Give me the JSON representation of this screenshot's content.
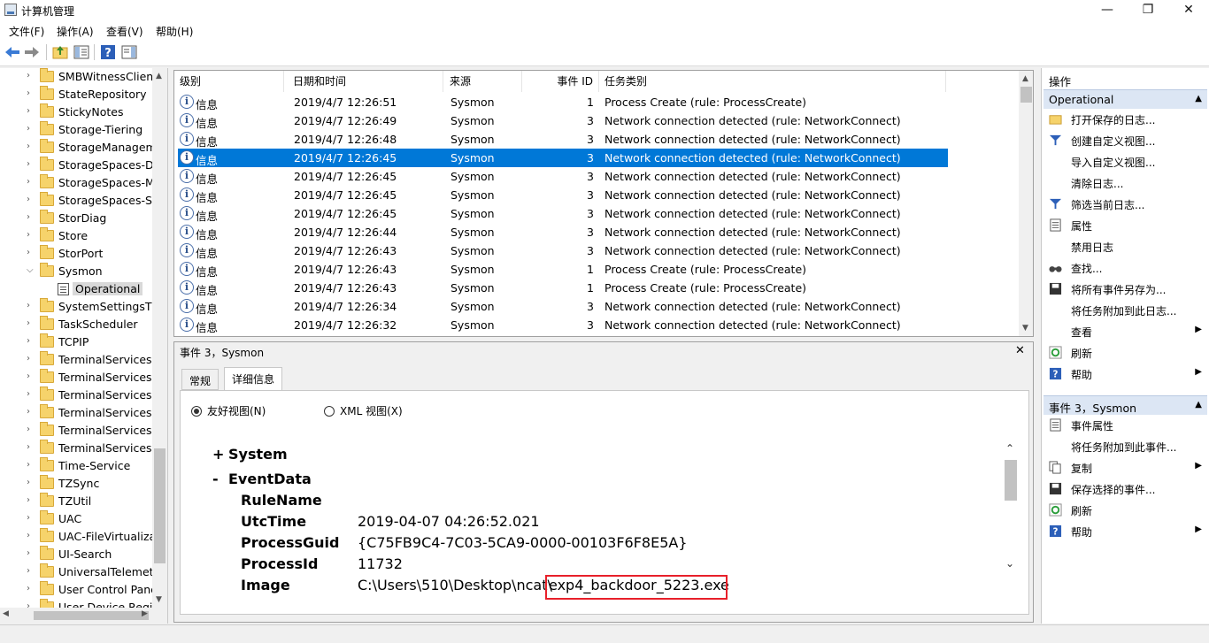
{
  "window": {
    "title": "计算机管理",
    "minimize": "—",
    "maximize": "❐",
    "close": "✕"
  },
  "menu": [
    "文件(F)",
    "操作(A)",
    "查看(V)",
    "帮助(H)"
  ],
  "tree": {
    "items": [
      {
        "label": "SMBWitnessClient",
        "expanded": false
      },
      {
        "label": "StateRepository",
        "expanded": false
      },
      {
        "label": "StickyNotes",
        "expanded": false
      },
      {
        "label": "Storage-Tiering",
        "expanded": false
      },
      {
        "label": "StorageManagem",
        "expanded": false
      },
      {
        "label": "StorageSpaces-Dr",
        "expanded": false
      },
      {
        "label": "StorageSpaces-M",
        "expanded": false
      },
      {
        "label": "StorageSpaces-Sp",
        "expanded": false
      },
      {
        "label": "StorDiag",
        "expanded": false
      },
      {
        "label": "Store",
        "expanded": false
      },
      {
        "label": "StorPort",
        "expanded": false
      },
      {
        "label": "Sysmon",
        "expanded": true
      },
      {
        "label": "Operational",
        "child": true
      },
      {
        "label": "SystemSettingsThr",
        "expanded": false
      },
      {
        "label": "TaskScheduler",
        "expanded": false
      },
      {
        "label": "TCPIP",
        "expanded": false
      },
      {
        "label": "TerminalServices-C",
        "expanded": false
      },
      {
        "label": "TerminalServices-C",
        "expanded": false
      },
      {
        "label": "TerminalServices-L",
        "expanded": false
      },
      {
        "label": "TerminalServices-F",
        "expanded": false
      },
      {
        "label": "TerminalServices-F",
        "expanded": false
      },
      {
        "label": "TerminalServices-F",
        "expanded": false
      },
      {
        "label": "Time-Service",
        "expanded": false
      },
      {
        "label": "TZSync",
        "expanded": false
      },
      {
        "label": "TZUtil",
        "expanded": false
      },
      {
        "label": "UAC",
        "expanded": false
      },
      {
        "label": "UAC-FileVirtualizat",
        "expanded": false
      },
      {
        "label": "UI-Search",
        "expanded": false
      },
      {
        "label": "UniversalTelemetr",
        "expanded": false
      },
      {
        "label": "User Control Pane",
        "expanded": false
      },
      {
        "label": "User Device Regis",
        "expanded": false
      }
    ]
  },
  "list": {
    "columns": [
      "级别",
      "日期和时间",
      "来源",
      "事件 ID",
      "任务类别"
    ],
    "rows": [
      {
        "level": "信息",
        "datetime": "2019/4/7 12:26:51",
        "source": "Sysmon",
        "id": "1",
        "task": "Process Create (rule: ProcessCreate)"
      },
      {
        "level": "信息",
        "datetime": "2019/4/7 12:26:49",
        "source": "Sysmon",
        "id": "3",
        "task": "Network connection detected (rule: NetworkConnect)"
      },
      {
        "level": "信息",
        "datetime": "2019/4/7 12:26:48",
        "source": "Sysmon",
        "id": "3",
        "task": "Network connection detected (rule: NetworkConnect)"
      },
      {
        "level": "信息",
        "datetime": "2019/4/7 12:26:45",
        "source": "Sysmon",
        "id": "3",
        "task": "Network connection detected (rule: NetworkConnect)",
        "selected": true
      },
      {
        "level": "信息",
        "datetime": "2019/4/7 12:26:45",
        "source": "Sysmon",
        "id": "3",
        "task": "Network connection detected (rule: NetworkConnect)"
      },
      {
        "level": "信息",
        "datetime": "2019/4/7 12:26:45",
        "source": "Sysmon",
        "id": "3",
        "task": "Network connection detected (rule: NetworkConnect)"
      },
      {
        "level": "信息",
        "datetime": "2019/4/7 12:26:45",
        "source": "Sysmon",
        "id": "3",
        "task": "Network connection detected (rule: NetworkConnect)"
      },
      {
        "level": "信息",
        "datetime": "2019/4/7 12:26:44",
        "source": "Sysmon",
        "id": "3",
        "task": "Network connection detected (rule: NetworkConnect)"
      },
      {
        "level": "信息",
        "datetime": "2019/4/7 12:26:43",
        "source": "Sysmon",
        "id": "3",
        "task": "Network connection detected (rule: NetworkConnect)"
      },
      {
        "level": "信息",
        "datetime": "2019/4/7 12:26:43",
        "source": "Sysmon",
        "id": "1",
        "task": "Process Create (rule: ProcessCreate)"
      },
      {
        "level": "信息",
        "datetime": "2019/4/7 12:26:43",
        "source": "Sysmon",
        "id": "1",
        "task": "Process Create (rule: ProcessCreate)"
      },
      {
        "level": "信息",
        "datetime": "2019/4/7 12:26:34",
        "source": "Sysmon",
        "id": "3",
        "task": "Network connection detected (rule: NetworkConnect)"
      },
      {
        "level": "信息",
        "datetime": "2019/4/7 12:26:32",
        "source": "Sysmon",
        "id": "3",
        "task": "Network connection detected (rule: NetworkConnect)"
      }
    ]
  },
  "detail": {
    "title": "事件 3，Sysmon",
    "close": "✕",
    "tabs": [
      "常规",
      "详细信息"
    ],
    "view_friendly": "友好视图(N)",
    "view_xml": "XML 视图(X)",
    "system_toggle": "+",
    "system_label": "System",
    "eventdata_toggle": "-",
    "eventdata_label": "EventData",
    "fields": [
      {
        "name": "RuleName",
        "value": ""
      },
      {
        "name": "UtcTime",
        "value": "2019-04-07 04:26:52.021"
      },
      {
        "name": "ProcessGuid",
        "value": "{C75FB9C4-7C03-5CA9-0000-00103F6F8E5A}"
      },
      {
        "name": "ProcessId",
        "value": "11732"
      },
      {
        "name": "Image",
        "value_prefix": "C:\\Users\\510\\Desktop\\ncat\\",
        "value_highlight": "exp4_backdoor_5223.exe"
      }
    ],
    "highlight_color": "#e8202a"
  },
  "actions": {
    "header": "操作",
    "section1": "Operational",
    "section1_items": [
      "打开保存的日志...",
      "创建自定义视图...",
      "导入自定义视图...",
      "清除日志...",
      "筛选当前日志...",
      "属性",
      "禁用日志",
      "查找...",
      "将所有事件另存为...",
      "将任务附加到此日志...",
      "查看",
      "刷新",
      "帮助"
    ],
    "section2": "事件 3，Sysmon",
    "section2_items": [
      "事件属性",
      "将任务附加到此事件...",
      "复制",
      "保存选择的事件...",
      "刷新",
      "帮助"
    ]
  },
  "colors": {
    "selection": "#0078d7",
    "section_bg": "#dce6f4"
  }
}
